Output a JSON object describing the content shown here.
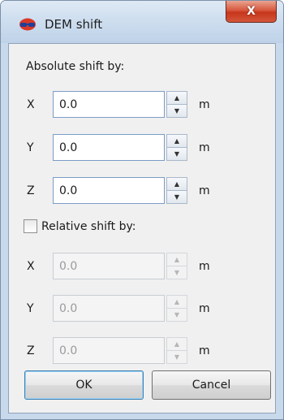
{
  "window": {
    "title": "DEM shift",
    "icon": "dem-globe-icon",
    "close_label": "X"
  },
  "absolute": {
    "label": "Absolute shift by:",
    "fields": [
      {
        "axis": "X",
        "value": "0.0",
        "unit": "m"
      },
      {
        "axis": "Y",
        "value": "0.0",
        "unit": "m"
      },
      {
        "axis": "Z",
        "value": "0.0",
        "unit": "m"
      }
    ]
  },
  "relative": {
    "label": "Relative shift by:",
    "checked": false,
    "fields": [
      {
        "axis": "X",
        "value": "0.0",
        "unit": "m"
      },
      {
        "axis": "Y",
        "value": "0.0",
        "unit": "m"
      },
      {
        "axis": "Z",
        "value": "0.0",
        "unit": "m"
      }
    ]
  },
  "buttons": {
    "ok": "OK",
    "cancel": "Cancel"
  },
  "colors": {
    "close_button": "#c6361c",
    "focus_border": "#3c7fb1"
  }
}
